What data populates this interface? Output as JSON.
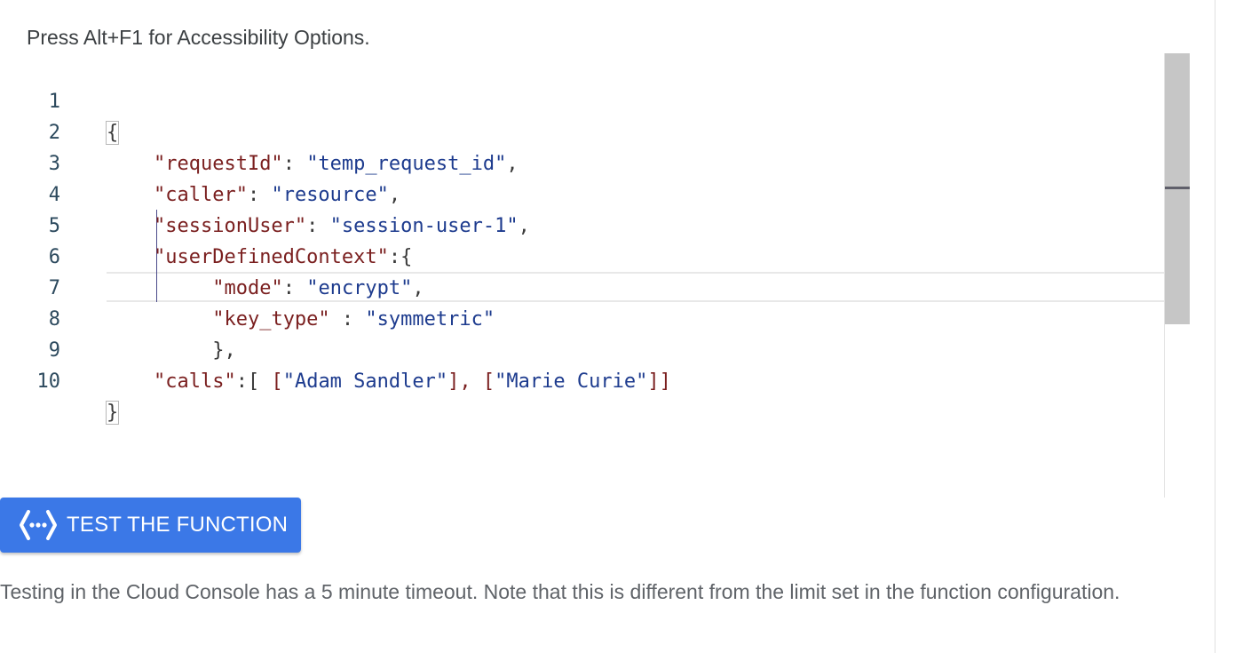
{
  "accessibility_hint": "Press Alt+F1 for Accessibility Options.",
  "editor": {
    "line_numbers": [
      "1",
      "2",
      "3",
      "4",
      "5",
      "6",
      "7",
      "8",
      "9",
      "10"
    ],
    "lines": {
      "l1": {
        "open": "{"
      },
      "l2": {
        "key": "\"requestId\"",
        "sep": ": ",
        "val": "\"temp_request_id\"",
        "end": ","
      },
      "l3": {
        "key": "\"caller\"",
        "sep": ": ",
        "val": "\"resource\"",
        "end": ","
      },
      "l4": {
        "key": "\"sessionUser\"",
        "sep": ": ",
        "val": "\"session-user-1\"",
        "end": ","
      },
      "l5": {
        "key": "\"userDefinedContext\"",
        "sep": ":{"
      },
      "l6": {
        "key": "\"mode\"",
        "sep": ": ",
        "val": "\"encrypt\"",
        "end": ","
      },
      "l7": {
        "key": "\"key_type\"",
        "sep": " : ",
        "val": "\"symmetric\""
      },
      "l8": {
        "close": "},"
      },
      "l9": {
        "key": "\"calls\"",
        "sep": ":[ ",
        "b1": "[",
        "v1": "\"Adam Sandler\"",
        "b2": "], ",
        "b3": "[",
        "v2": "\"Marie Curie\"",
        "b4": "]]"
      },
      "l10": {
        "close": "}"
      }
    }
  },
  "test_button": {
    "label": "TEST THE FUNCTION",
    "icon": "cloud-functions-icon"
  },
  "note": "Testing in the Cloud Console has a 5 minute timeout. Note that this is different from the limit set in the function configuration.",
  "colors": {
    "button_bg": "#3b78e7",
    "json_key": "#7a1f1f",
    "json_string": "#1d3b8e"
  }
}
